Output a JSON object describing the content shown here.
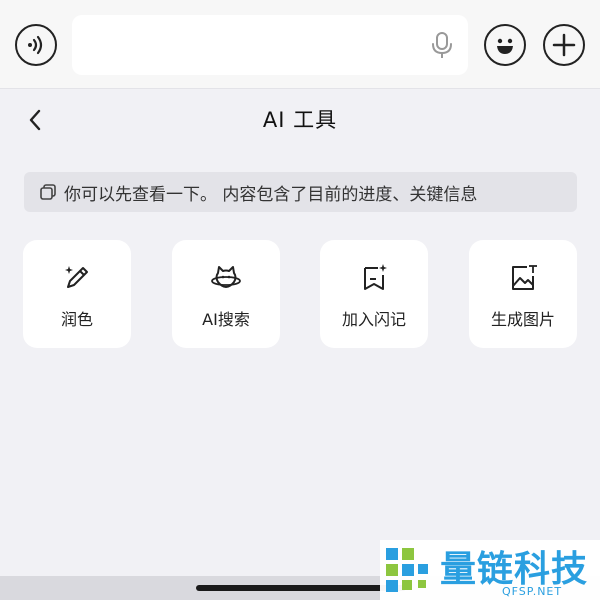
{
  "input_bar": {
    "voice_icon": "voice-wave-icon",
    "mic_icon": "microphone-icon",
    "emoji_icon": "smiley-icon",
    "plus_icon": "plus-icon"
  },
  "header": {
    "back_icon": "chevron-left-icon",
    "title": "AI 工具"
  },
  "quote": {
    "icon": "copy-icon",
    "text": "你可以先查看一下。 内容包含了目前的进度、关键信息"
  },
  "tools": [
    {
      "label": "润色",
      "icon": "magic-pen-icon"
    },
    {
      "label": "AI搜索",
      "icon": "ai-planet-icon"
    },
    {
      "label": "加入闪记",
      "icon": "bookmark-sparkle-icon"
    },
    {
      "label": "生成图片",
      "icon": "image-text-icon"
    }
  ],
  "watermark": {
    "brand": "量链科技",
    "sub": "QFSP.NET",
    "brand_color": "#2a9fe0"
  }
}
